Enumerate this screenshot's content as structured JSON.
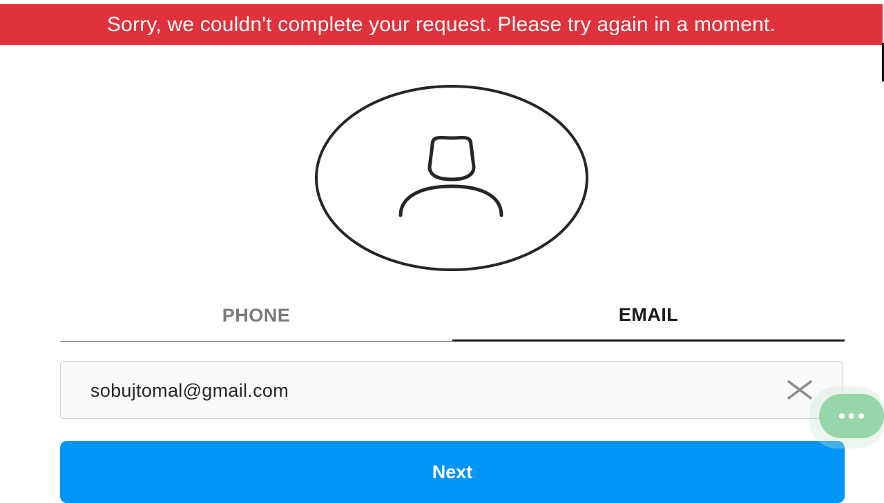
{
  "banner": {
    "message": "Sorry, we couldn't complete your request. Please try again in a moment.",
    "color": "#e0323c"
  },
  "avatar": {
    "icon": "user-silhouette-icon"
  },
  "tabs": [
    {
      "label": "PHONE",
      "selected": false
    },
    {
      "label": "EMAIL",
      "selected": true
    }
  ],
  "email_field": {
    "value": "sobujtomal@gmail.com",
    "clear_icon": "close-icon"
  },
  "next_button": {
    "label": "Next",
    "color": "#0095f6"
  },
  "floating_button": {
    "icon": "more-horizontal-icon",
    "color": "#8fd4a3"
  }
}
